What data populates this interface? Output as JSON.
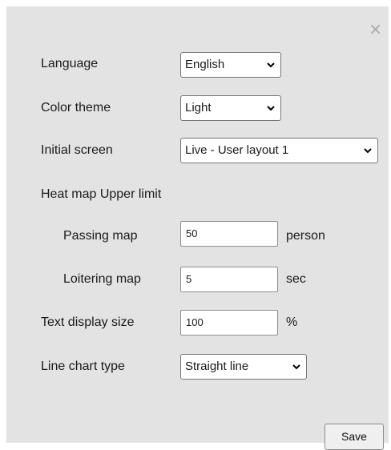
{
  "dialog": {
    "close_glyph": "×",
    "save_label": "Save"
  },
  "settings": {
    "language": {
      "label": "Language",
      "value": "English"
    },
    "color_theme": {
      "label": "Color theme",
      "value": "Light"
    },
    "initial_screen": {
      "label": "Initial screen",
      "value": "Live - User layout 1"
    },
    "heat_map_heading": "Heat map Upper limit",
    "passing_map": {
      "label": "Passing map",
      "value": "50",
      "unit": "person"
    },
    "loitering_map": {
      "label": "Loitering map",
      "value": "5",
      "unit": "sec"
    },
    "text_display_size": {
      "label": "Text display size",
      "value": "100",
      "unit": "%"
    },
    "line_chart_type": {
      "label": "Line chart type",
      "value": "Straight line"
    }
  },
  "icons": {
    "close": "close-icon",
    "dropdown": "chevron-down-icon"
  },
  "colors": {
    "dialog_background": "#e3e3e3",
    "close_icon": "#a6a6a6"
  }
}
